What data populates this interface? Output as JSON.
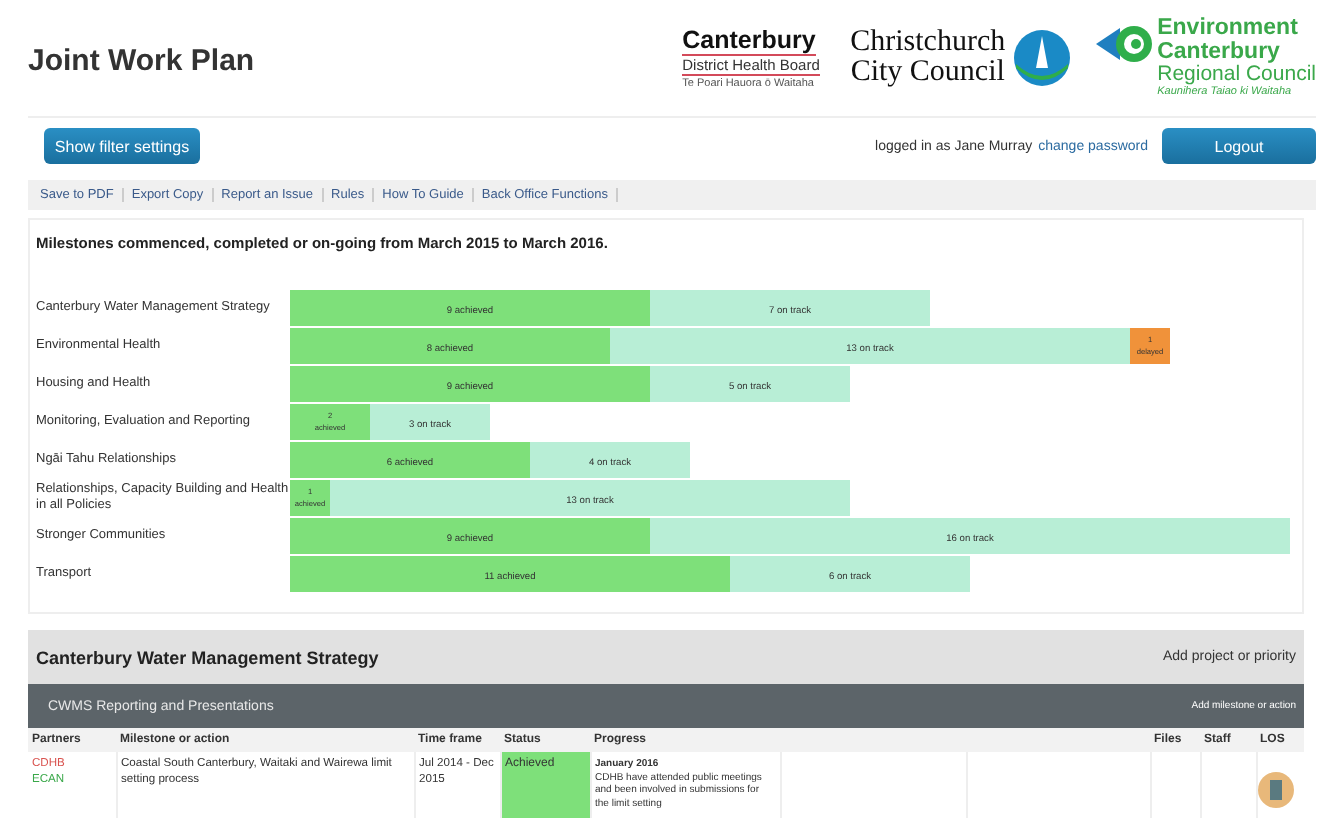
{
  "header": {
    "title": "Joint Work Plan",
    "logos": [
      {
        "kind": "cdhb",
        "lines": [
          "Canterbury",
          "District Health Board",
          "Te Poari Hauora ō Waitaha"
        ]
      },
      {
        "kind": "ccc",
        "lines": [
          "Christchurch",
          "City Council"
        ]
      },
      {
        "kind": "ecan",
        "lines": [
          "Environment",
          "Canterbury",
          "Regional Council",
          "Kaunihera Taiao ki Waitaha"
        ]
      }
    ]
  },
  "toolbar": {
    "filter_button": "Show filter settings",
    "logged_in_text": "logged in as Jane Murray",
    "change_password": "change password",
    "logout_button": "Logout"
  },
  "links": [
    "Save to PDF",
    "Export Copy",
    "Report an Issue",
    "Rules",
    "How To Guide",
    "Back Office Functions"
  ],
  "summary": {
    "heading": "Milestones commenced, completed or on-going from March 2015 to March 2016.",
    "chart_data": {
      "type": "bar",
      "orientation": "horizontal",
      "stacked": true,
      "categories": [
        "Canterbury Water Management Strategy",
        "Environmental Health",
        "Housing and Health",
        "Monitoring, Evaluation and Reporting",
        "Ngāi Tahu Relationships",
        "Relationships, Capacity Building and Health in all Policies",
        "Stronger Communities",
        "Transport"
      ],
      "series": [
        {
          "color": "#7ee07a",
          "values": [
            9,
            8,
            9,
            2,
            6,
            1,
            9,
            11
          ],
          "value_labels": [
            "9 achieved",
            "8 achieved",
            "9 achieved",
            "2 achieved",
            "6 achieved",
            "1 achieved",
            "9 achieved",
            "11 achieved"
          ]
        },
        {
          "color": "#b8eed6",
          "values": [
            7,
            13,
            5,
            3,
            4,
            13,
            16,
            6
          ],
          "value_labels": [
            "7 on track",
            "13 on track",
            "5 on track",
            "3 on track",
            "4 on track",
            "13 on track",
            "16 on track",
            "6 on track"
          ]
        },
        {
          "color": "#f0923a",
          "values": [
            null,
            1,
            null,
            null,
            null,
            null,
            null,
            null
          ],
          "value_labels": [
            null,
            "1 delayed",
            null,
            null,
            null,
            null,
            null,
            null
          ]
        }
      ]
    }
  },
  "section": {
    "title": "Canterbury Water Management Strategy",
    "add_link": "Add project or priority",
    "subsection": {
      "title": "CWMS Reporting and Presentations",
      "add_link": "Add milestone or action"
    },
    "columns": [
      "Partners",
      "Milestone or action",
      "Time frame",
      "Status",
      "Progress"
    ],
    "trailing_columns": [
      "Files",
      "Staff",
      "LOS"
    ],
    "rows": [
      {
        "partners": [
          {
            "name": "CDHB",
            "color": "#d9534f"
          },
          {
            "name": "ECAN",
            "color": "#3aa84a"
          }
        ],
        "milestone": "Coastal South Canterbury, Waitaki and Wairewa limit setting process",
        "time_frame": "Jul 2014 - Dec 2015",
        "status": {
          "kind": "achieved",
          "label": "Achieved"
        },
        "progress_date": "January 2016",
        "progress_text": "CDHB have attended public meetings and been involved in submissions for the limit setting"
      }
    ]
  }
}
